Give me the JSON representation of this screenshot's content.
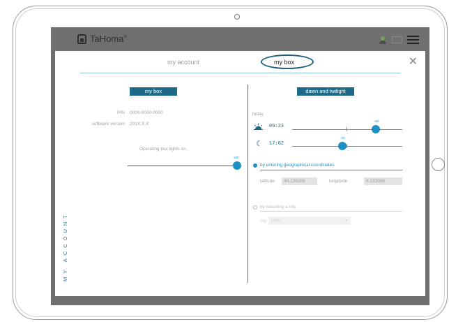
{
  "app": {
    "brand": "TaHoma",
    "trademark": "®"
  },
  "tabs": {
    "account": "my account",
    "box": "my box"
  },
  "close_label": "✕",
  "side_label": "MY ACCOUNT",
  "left": {
    "header": "my box",
    "pin_label": "PIN",
    "pin_value": "0000-0000-0000",
    "software_label": "software version",
    "software_value": "201X.X.X",
    "lights_label": "Operating box lights on",
    "lights_value": "100",
    "lights_level": 1.0
  },
  "right": {
    "header": "dawn and twilight",
    "today_label": "today",
    "sunrise_time": "09:33",
    "sunrise_offset": "+60",
    "sunset_time": "17:02",
    "sunset_offset": "-18",
    "option_coords_label": "by entering geographical coordinates",
    "latitude_label": "latitude",
    "latitude_value": "48.136389",
    "longitude_label": "longitude",
    "longitude_value": "6.133056",
    "option_city_label": "by selecting a city",
    "city_label": "city",
    "city_value": "Lyon"
  },
  "colors": {
    "accent": "#1e8fc2",
    "header": "#1c6a88",
    "overlay": "#6f6f6f"
  }
}
